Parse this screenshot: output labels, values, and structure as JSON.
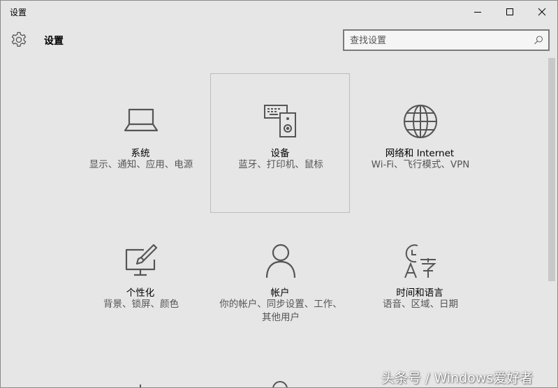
{
  "window": {
    "title": "设置"
  },
  "header": {
    "title": "设置",
    "gear_icon": "gear-icon"
  },
  "search": {
    "placeholder": "查找设置",
    "icon": "search-icon"
  },
  "tiles": [
    {
      "title": "系统",
      "desc": "显示、通知、应用、电源",
      "icon": "laptop-icon"
    },
    {
      "title": "设备",
      "desc": "蓝牙、打印机、鼠标",
      "icon": "devices-icon",
      "selected": true
    },
    {
      "title": "网络和 Internet",
      "desc": "Wi-Fi、飞行模式、VPN",
      "icon": "globe-icon"
    },
    {
      "title": "个性化",
      "desc": "背景、锁屏、颜色",
      "icon": "personalization-icon"
    },
    {
      "title": "帐户",
      "desc": "你的帐户、同步设置、工作、其他用户",
      "icon": "person-icon"
    },
    {
      "title": "时间和语言",
      "desc": "语音、区域、日期",
      "icon": "time-language-icon"
    }
  ],
  "watermark": {
    "text": "头条号 / Windows爱好者"
  },
  "colors": {
    "background": "#e6e6e6",
    "icon_stroke": "#555555",
    "selected_border": "#bdbdbd"
  }
}
